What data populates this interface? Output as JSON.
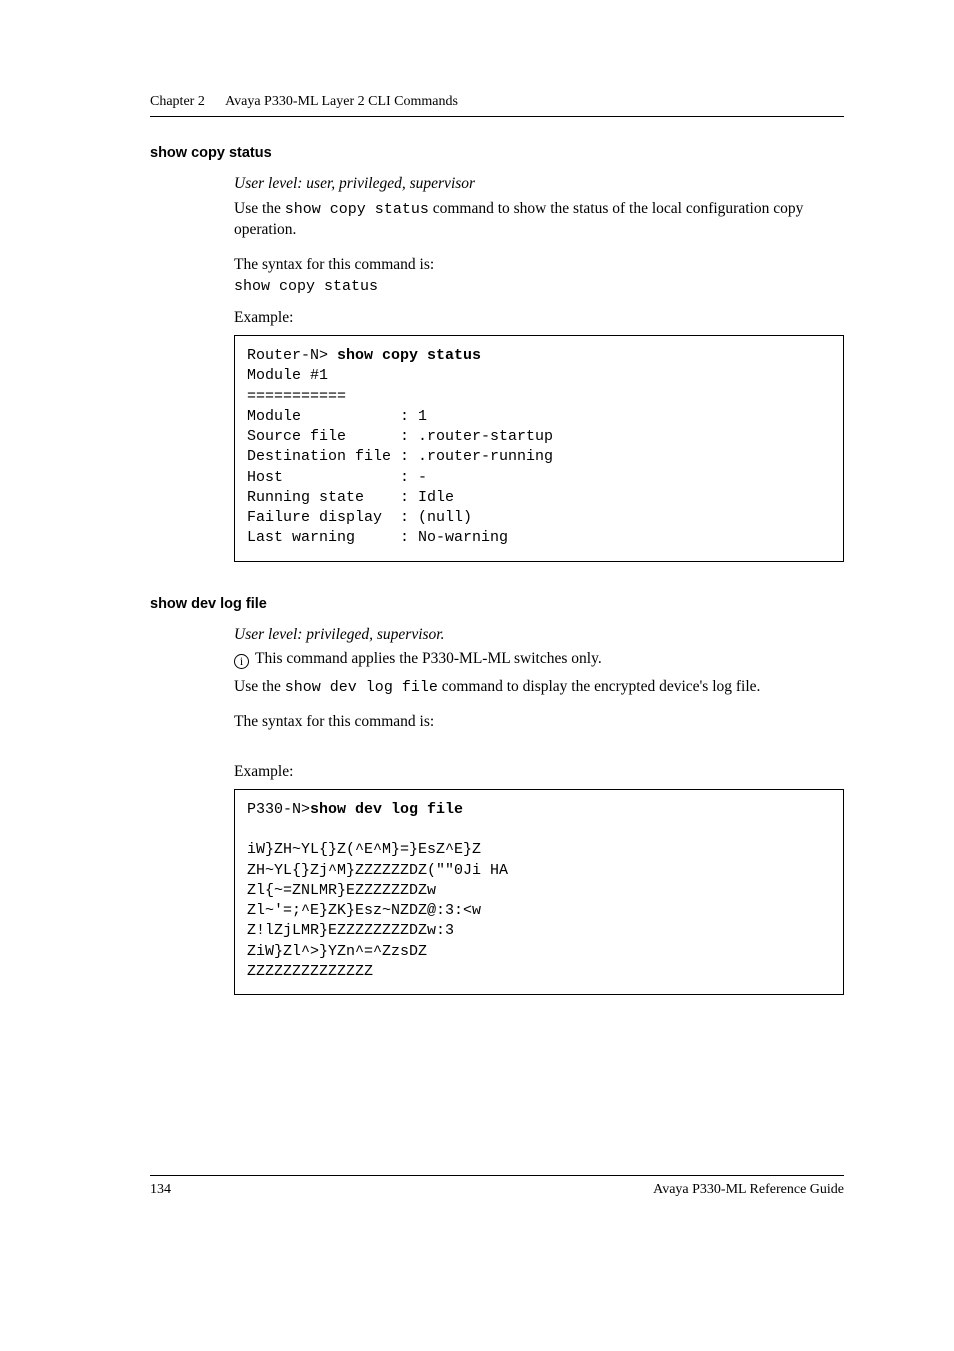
{
  "runningHead": {
    "chapter": "Chapter 2",
    "title": "Avaya P330-ML Layer 2 CLI Commands"
  },
  "section1": {
    "title": "show copy status",
    "userLevel": "User level: user, privileged, supervisor",
    "para1_a": "Use the ",
    "para1_code": "show copy status",
    "para1_b": " command to show the status of the local configuration copy operation.",
    "syntaxLabel": "The syntax for this command is:",
    "syntaxCmd": "show copy status",
    "exampleLabel": "Example:",
    "code_prompt": "Router-N> ",
    "code_cmd": "show copy status",
    "code_body": "Module #1\n===========\nModule           : 1\nSource file      : .router-startup\nDestination file : .router-running\nHost             : -\nRunning state    : Idle\nFailure display  : (null)\nLast warning     : No-warning"
  },
  "section2": {
    "title": "show dev log file",
    "userLevel": "User level: privileged, supervisor.",
    "note": "This command applies the P330-ML-ML switches only.",
    "para1_a": "Use the ",
    "para1_code": "show dev log file",
    "para1_b": " command to display the encrypted device's log file.",
    "syntaxLabel": "The syntax for this command is:",
    "exampleLabel": "Example:",
    "code_prompt": "P330-N>",
    "code_cmd": "show dev log file",
    "code_body": "iW}ZH~YL{}Z(^E^M}=}EsZ^E}Z\nZH~YL{}Zj^M}ZZZZZZDZ(\"\"0Ji HA\nZl{~=ZNLMR}EZZZZZZDZw\nZl~'=;^E}ZK}Esz~NZDZ@:3:<w\nZ!lZjLMR}EZZZZZZZZDZw:3\nZiW}Zl^>}YZn^=^ZzsDZ\nZZZZZZZZZZZZZZ"
  },
  "footer": {
    "page": "134",
    "guide": "Avaya P330-ML Reference Guide"
  }
}
